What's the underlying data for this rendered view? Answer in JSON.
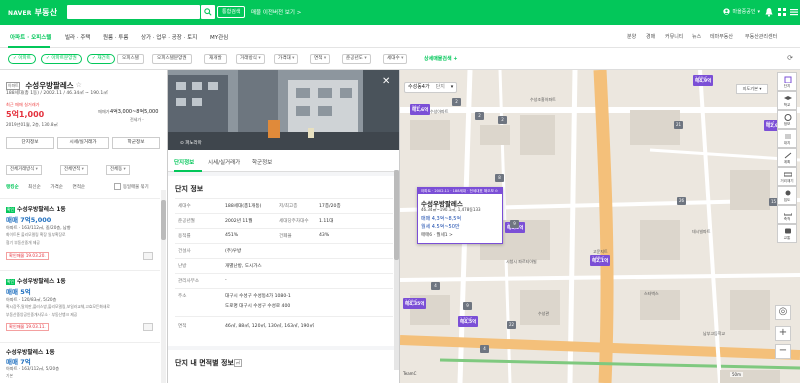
{
  "header": {
    "logo_naver": "NAVER",
    "logo_service": "부동산",
    "search_value": "",
    "combo_btn": "통합검색",
    "old_version": "매물 이전버전 보기 >",
    "user_name": "마을중공인"
  },
  "nav": {
    "items": [
      "아파트 · 오피스텔",
      "빌라 · 주택",
      "원룸 · 투룸",
      "상가 · 업무 · 공장 · 토지",
      "MY관심"
    ],
    "right": [
      "분양",
      "경매",
      "커뮤니티",
      "뉴스",
      "테마부동산",
      "부동산관리센터"
    ]
  },
  "filters": {
    "chips": [
      "아파트",
      "아파트분양권",
      "재건축",
      "오피스텔",
      "오피스텔분양권",
      "재개발"
    ],
    "selects": [
      "거래방식",
      "가격대",
      "면적",
      "준공년도",
      "세대수"
    ],
    "detail": "상세매물검색",
    "plus": "+"
  },
  "complex": {
    "badge": "아파트",
    "name": "수성우방팔레스",
    "star": "☆",
    "info": "188세대(총 1동) / 2002.11 / 46.34㎡ ~ 190.1㎡",
    "recent_label": "최근 매매 실거래가",
    "recent_price": "5억1,000",
    "recent_date": "2019년01월, 2층, 130.8㎡",
    "sale_label": "매매가",
    "sale_range": "4억3,000~8억5,000",
    "rent_label": "전세가 -",
    "btn_complex": "단지정보",
    "btn_market": "시세/실거래가",
    "btn_school": "학군정보",
    "sel_trade": "전체거래방식",
    "sel_area": "전체면적",
    "sel_dong": "전체동",
    "sort": [
      "랭킹순",
      "최신순",
      "가격순",
      "면적순"
    ],
    "bundle": "동일매물 묶기"
  },
  "listings": [
    {
      "tag": "확인",
      "title": "수성우방팔레스 1동",
      "price": "매매 7억5,000",
      "spec": "아파트 · 163/112㎡, 중/20층, 남향",
      "sub": "화이트톤 올리모델링 확장 일부확장로",
      "agent": "협기 부동산중개 제공",
      "confirm": "확인매물 19.03.20."
    },
    {
      "tag": "확인",
      "title": "수성우방팔레스 1동",
      "price": "매매 5억",
      "spec": "아파트 · 120/83㎡, 5/20층",
      "sub": "확시장주,탈의판,플러스방,올리모델링,보일러교체,고효모든화새로",
      "agent": "부동산중앙공인중개사무소 · 부동산뱅크 제공",
      "confirm": "확인매물 19.03.11."
    },
    {
      "tag": "",
      "title": "수성우방팔레스 1동",
      "price": "매매 7억",
      "spec": "아파트 · 163/112㎡, 5/20층",
      "sub": "기본",
      "agent": "",
      "confirm": ""
    }
  ],
  "detail": {
    "photo_caption": "파노라마",
    "tabs": [
      "단지정보",
      "시세/실거래가",
      "학군정보"
    ],
    "info_title": "단지 정보",
    "rows": [
      {
        "l1": "세대수",
        "v1": "188세대(총1개동)",
        "l2": "저/최고층",
        "v2": "17층/20층"
      },
      {
        "l1": "준공년월",
        "v1": "2002년 11월",
        "l2": "세대당주차대수",
        "v2": "1.11대"
      },
      {
        "l1": "용적률",
        "v1": "451%",
        "l2": "건폐율",
        "v2": "43%"
      },
      {
        "l1": "건설사",
        "v1": "(주)우방",
        "l2": "",
        "v2": ""
      },
      {
        "l1": "난방",
        "v1": "개별난방, 도시가스",
        "l2": "",
        "v2": ""
      },
      {
        "l1": "관리사무소",
        "v1": "-",
        "l2": "",
        "v2": ""
      },
      {
        "l1": "주소",
        "v1": "대구시 수성구 수성동4가 1080-1",
        "l2": "",
        "v2": ""
      },
      {
        "l1": "",
        "v1": "도로명  대구시 수성구 수성로 400",
        "l2": "",
        "v2": ""
      },
      {
        "l1": "면적",
        "v1": "46㎡, 88㎡, 120㎡, 130㎡, 163㎡, 190㎡",
        "l2": "",
        "v2": ""
      }
    ],
    "area_title": "단지 내 면적별 정보",
    "area_badge": "㎡"
  },
  "map": {
    "loc": "수성동4가",
    "unit": "단지",
    "map_type": "지도기본 ▾",
    "popup": {
      "bar": "아파트 · 2002.11 · 188세대 · 전세대표 해오보 ⊙",
      "name": "수성우방팔레스",
      "spec": "46.34㎡~190.1㎡, 1,478동133",
      "sale": "매매 4,3억~8,5억",
      "rent": "월세 4.5억~50만",
      "more": "매매6 · 월세1 >"
    },
    "pins": [
      {
        "top": "1,60㎡",
        "price": "매4,9억"
      },
      {
        "top": "56㎡",
        "price": "매1,6억"
      },
      {
        "top": "148㎡",
        "price": "매6,5억"
      },
      {
        "top": "1,68㎡",
        "price": "매2,1억"
      },
      {
        "top": "1,04㎡",
        "price": "매4,35억"
      },
      {
        "top": "1,32㎡",
        "price": "매4,5억"
      },
      {
        "top": "68㎡",
        "price": "매2,9억"
      }
    ],
    "counts": [
      "2",
      "2",
      "2",
      "21",
      "8",
      "26",
      "15",
      "4",
      "9",
      "4",
      "22",
      "4",
      "9"
    ],
    "labels": [
      "수성아파트",
      "수성조흥아파트",
      "수성1트",
      "시청시 파르티아빌",
      "고운지트",
      "데시빌파트",
      "무지장아파트",
      "스타벅스",
      "남부고등학교",
      "수성관"
    ],
    "tools": [
      "단지",
      "학교",
      "정보",
      "대지",
      "계획",
      "거리재기",
      "집도",
      "축척",
      "교통"
    ],
    "scale": "50m",
    "corner": "TeamC"
  }
}
